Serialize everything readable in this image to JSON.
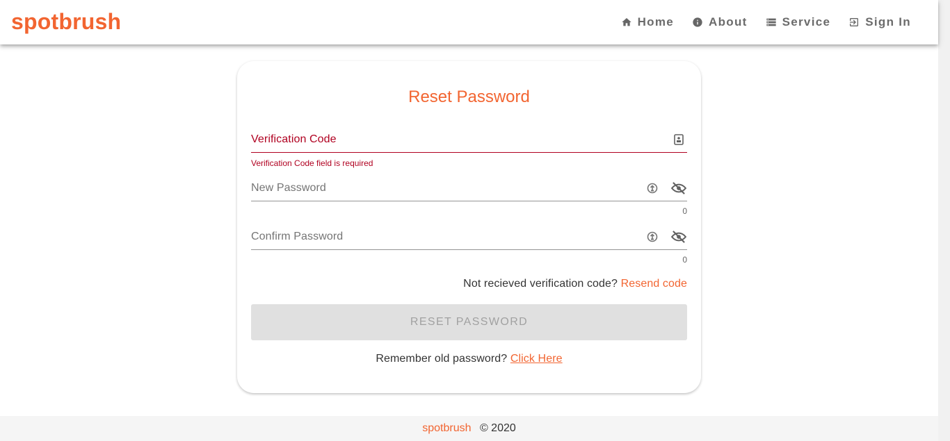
{
  "brand": "spotbrush",
  "nav": {
    "home": "Home",
    "about": "About",
    "service": "Service",
    "signin": "Sign In"
  },
  "card": {
    "title": "Reset Password",
    "verification": {
      "placeholder": "Verification Code",
      "error": "Verification Code field is required"
    },
    "new_password": {
      "placeholder": "New Password",
      "counter": "0"
    },
    "confirm_password": {
      "placeholder": "Confirm Password",
      "counter": "0"
    },
    "resend": {
      "prompt": "Not recieved verification code?",
      "link": "Resend code"
    },
    "reset_button": "RESET PASSWORD",
    "remember": {
      "prompt": "Remember old password?",
      "link": "Click Here"
    }
  },
  "footer": {
    "brand": "spotbrush",
    "copyright": "© 2020"
  },
  "colors": {
    "accent": "#f26531",
    "error": "#b00020",
    "disabled_button": "#e0e0e0"
  }
}
